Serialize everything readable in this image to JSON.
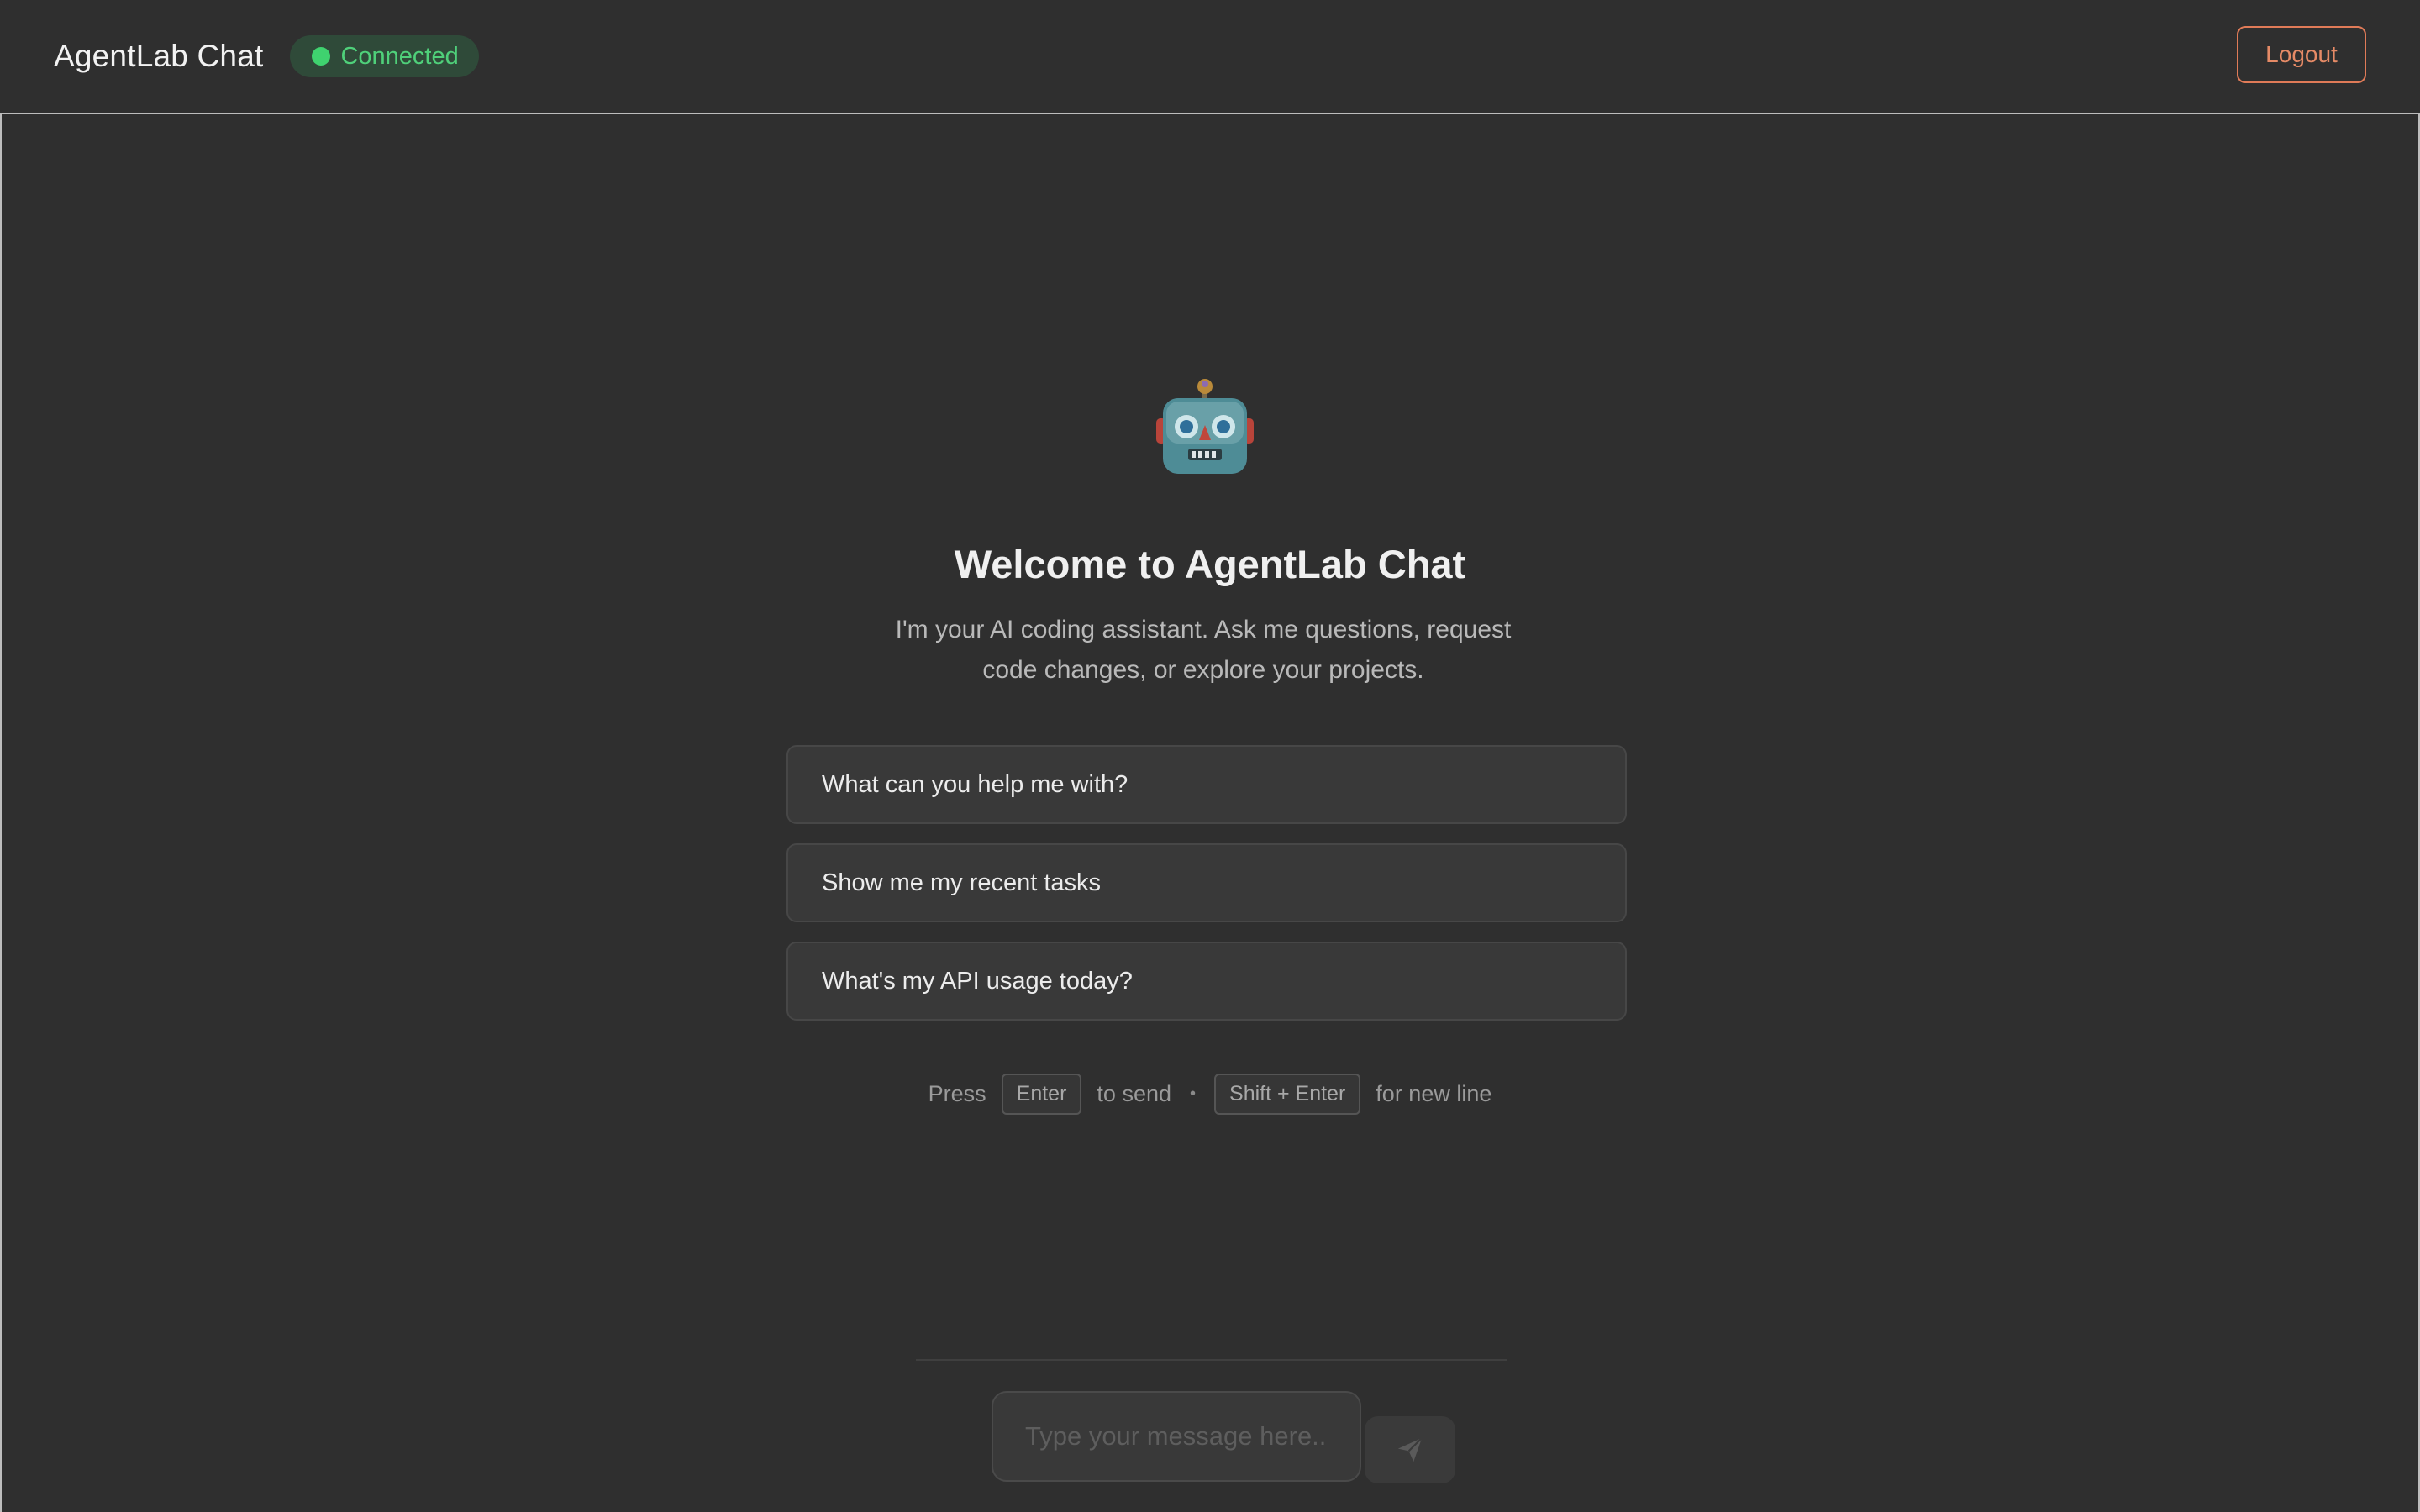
{
  "header": {
    "title": "AgentLab Chat",
    "status": "Connected",
    "logout_label": "Logout"
  },
  "welcome": {
    "icon": "robot-icon",
    "title": "Welcome to AgentLab Chat",
    "subtitle": "I'm your AI coding assistant. Ask me questions, request code changes, or explore your projects."
  },
  "suggestions": [
    "What can you help me with?",
    "Show me my recent tasks",
    "What's my API usage today?"
  ],
  "hint": {
    "press": "Press",
    "enter_key": "Enter",
    "to_send": "to send",
    "separator": "•",
    "shift_enter_key": "Shift + Enter",
    "new_line": "for new line"
  },
  "composer": {
    "placeholder": "Type your message here...",
    "send_icon": "send-icon"
  },
  "colors": {
    "background": "#2f2f2f",
    "status_green": "#3fd26f",
    "logout_accent": "#e07b58"
  }
}
